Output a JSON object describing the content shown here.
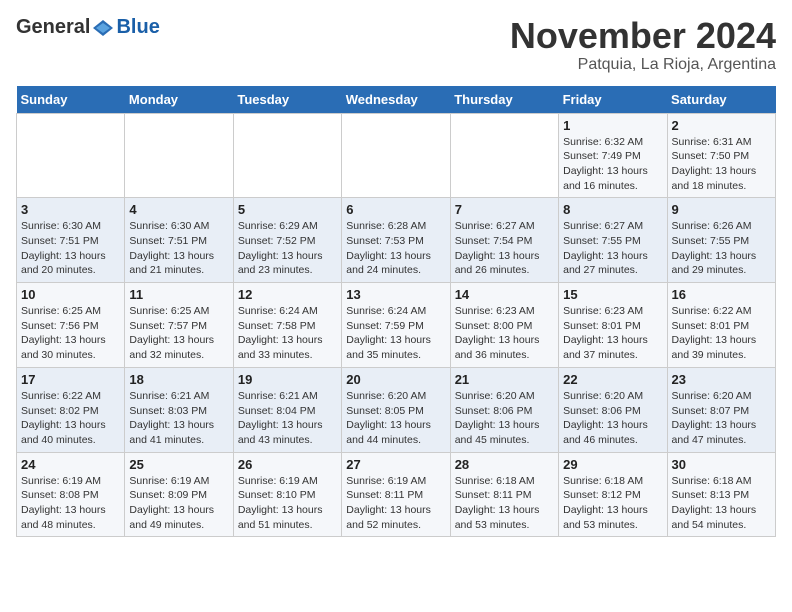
{
  "header": {
    "logo_general": "General",
    "logo_blue": "Blue",
    "month_title": "November 2024",
    "location": "Patquia, La Rioja, Argentina"
  },
  "days_of_week": [
    "Sunday",
    "Monday",
    "Tuesday",
    "Wednesday",
    "Thursday",
    "Friday",
    "Saturday"
  ],
  "weeks": [
    [
      {
        "day": "",
        "info": ""
      },
      {
        "day": "",
        "info": ""
      },
      {
        "day": "",
        "info": ""
      },
      {
        "day": "",
        "info": ""
      },
      {
        "day": "",
        "info": ""
      },
      {
        "day": "1",
        "info": "Sunrise: 6:32 AM\nSunset: 7:49 PM\nDaylight: 13 hours and 16 minutes."
      },
      {
        "day": "2",
        "info": "Sunrise: 6:31 AM\nSunset: 7:50 PM\nDaylight: 13 hours and 18 minutes."
      }
    ],
    [
      {
        "day": "3",
        "info": "Sunrise: 6:30 AM\nSunset: 7:51 PM\nDaylight: 13 hours and 20 minutes."
      },
      {
        "day": "4",
        "info": "Sunrise: 6:30 AM\nSunset: 7:51 PM\nDaylight: 13 hours and 21 minutes."
      },
      {
        "day": "5",
        "info": "Sunrise: 6:29 AM\nSunset: 7:52 PM\nDaylight: 13 hours and 23 minutes."
      },
      {
        "day": "6",
        "info": "Sunrise: 6:28 AM\nSunset: 7:53 PM\nDaylight: 13 hours and 24 minutes."
      },
      {
        "day": "7",
        "info": "Sunrise: 6:27 AM\nSunset: 7:54 PM\nDaylight: 13 hours and 26 minutes."
      },
      {
        "day": "8",
        "info": "Sunrise: 6:27 AM\nSunset: 7:55 PM\nDaylight: 13 hours and 27 minutes."
      },
      {
        "day": "9",
        "info": "Sunrise: 6:26 AM\nSunset: 7:55 PM\nDaylight: 13 hours and 29 minutes."
      }
    ],
    [
      {
        "day": "10",
        "info": "Sunrise: 6:25 AM\nSunset: 7:56 PM\nDaylight: 13 hours and 30 minutes."
      },
      {
        "day": "11",
        "info": "Sunrise: 6:25 AM\nSunset: 7:57 PM\nDaylight: 13 hours and 32 minutes."
      },
      {
        "day": "12",
        "info": "Sunrise: 6:24 AM\nSunset: 7:58 PM\nDaylight: 13 hours and 33 minutes."
      },
      {
        "day": "13",
        "info": "Sunrise: 6:24 AM\nSunset: 7:59 PM\nDaylight: 13 hours and 35 minutes."
      },
      {
        "day": "14",
        "info": "Sunrise: 6:23 AM\nSunset: 8:00 PM\nDaylight: 13 hours and 36 minutes."
      },
      {
        "day": "15",
        "info": "Sunrise: 6:23 AM\nSunset: 8:01 PM\nDaylight: 13 hours and 37 minutes."
      },
      {
        "day": "16",
        "info": "Sunrise: 6:22 AM\nSunset: 8:01 PM\nDaylight: 13 hours and 39 minutes."
      }
    ],
    [
      {
        "day": "17",
        "info": "Sunrise: 6:22 AM\nSunset: 8:02 PM\nDaylight: 13 hours and 40 minutes."
      },
      {
        "day": "18",
        "info": "Sunrise: 6:21 AM\nSunset: 8:03 PM\nDaylight: 13 hours and 41 minutes."
      },
      {
        "day": "19",
        "info": "Sunrise: 6:21 AM\nSunset: 8:04 PM\nDaylight: 13 hours and 43 minutes."
      },
      {
        "day": "20",
        "info": "Sunrise: 6:20 AM\nSunset: 8:05 PM\nDaylight: 13 hours and 44 minutes."
      },
      {
        "day": "21",
        "info": "Sunrise: 6:20 AM\nSunset: 8:06 PM\nDaylight: 13 hours and 45 minutes."
      },
      {
        "day": "22",
        "info": "Sunrise: 6:20 AM\nSunset: 8:06 PM\nDaylight: 13 hours and 46 minutes."
      },
      {
        "day": "23",
        "info": "Sunrise: 6:20 AM\nSunset: 8:07 PM\nDaylight: 13 hours and 47 minutes."
      }
    ],
    [
      {
        "day": "24",
        "info": "Sunrise: 6:19 AM\nSunset: 8:08 PM\nDaylight: 13 hours and 48 minutes."
      },
      {
        "day": "25",
        "info": "Sunrise: 6:19 AM\nSunset: 8:09 PM\nDaylight: 13 hours and 49 minutes."
      },
      {
        "day": "26",
        "info": "Sunrise: 6:19 AM\nSunset: 8:10 PM\nDaylight: 13 hours and 51 minutes."
      },
      {
        "day": "27",
        "info": "Sunrise: 6:19 AM\nSunset: 8:11 PM\nDaylight: 13 hours and 52 minutes."
      },
      {
        "day": "28",
        "info": "Sunrise: 6:18 AM\nSunset: 8:11 PM\nDaylight: 13 hours and 53 minutes."
      },
      {
        "day": "29",
        "info": "Sunrise: 6:18 AM\nSunset: 8:12 PM\nDaylight: 13 hours and 53 minutes."
      },
      {
        "day": "30",
        "info": "Sunrise: 6:18 AM\nSunset: 8:13 PM\nDaylight: 13 hours and 54 minutes."
      }
    ]
  ]
}
